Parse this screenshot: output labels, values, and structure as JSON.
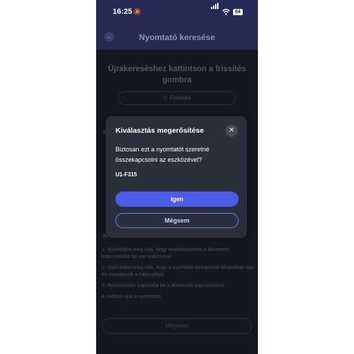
{
  "status": {
    "time": "16:25",
    "battery": "64"
  },
  "header": {
    "title": "Nyomtató keresése",
    "back_icon": "back-arrow-icon"
  },
  "background": {
    "instruction": "Újrakereséshez kattintson a frissítés gombra",
    "refresh_label": "Frissítés",
    "list_heading_peek": "E",
    "notes_heading_peek": "N",
    "steps": [
      "1. Győződjön meg róla, hogy mobileszközén a Bluetooth kapcsolódás be van kapcsolva",
      "2. Győződjön meg róla, hogy a nyomtató bekapcsolt állapotban van és csatlakozik a hálózathoz",
      "3. Nyomtatóján kapcsolja be a Bluetooth kapcsolódást",
      "4. Indítsa újra a nyomtatót"
    ],
    "cancel_label": "Mégsem"
  },
  "modal": {
    "title": "Kiválasztás megerősítése",
    "body": "Biztosan ezt a nyomtatót szeretné összekapcsolni az eszközével?",
    "device_code": "U1-F315",
    "confirm_label": "Igen",
    "cancel_label": "Mégsem"
  },
  "colors": {
    "accent": "#4c5ce8",
    "header": "#262a55",
    "surface": "#2b2f3c",
    "background": "#1b1f29"
  }
}
